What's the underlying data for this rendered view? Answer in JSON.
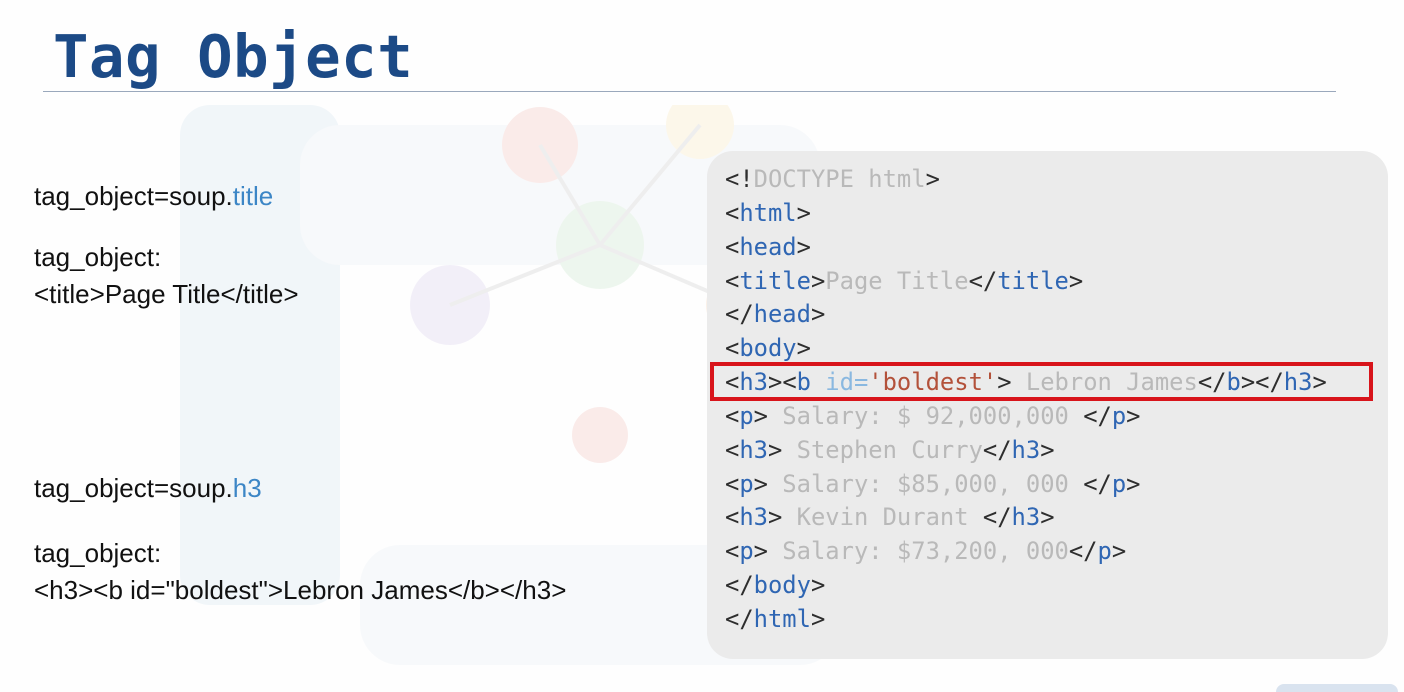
{
  "slide": {
    "title": "Tag Object"
  },
  "left": {
    "ex1_code_prefix": "tag_object=soup.",
    "ex1_code_attr": "title",
    "ex1_label": "tag_object:",
    "ex1_result": "<title>Page Title</title>",
    "ex2_code_prefix": "tag_object=soup.",
    "ex2_code_attr": "h3",
    "ex2_label": "tag_object:",
    "ex2_result": "<h3><b id=\"boldest\">Lebron James</b></h3>"
  },
  "code": {
    "l1_open": "<!",
    "l1_text": "DOCTYPE html",
    "l1_close": ">",
    "l2_open": "<",
    "l2_tag": "html",
    "l2_close": ">",
    "l3_open": "<",
    "l3_tag": "head",
    "l3_close": ">",
    "l4_open": "<",
    "l4_tag": "title",
    "l4_close": ">",
    "l4_text": "Page Title",
    "l4_open2": "</",
    "l4_tag2": "title",
    "l4_close2": ">",
    "l5_open": "</",
    "l5_tag": "head",
    "l5_close": ">",
    "l6_open": "<",
    "l6_tag": "body",
    "l6_close": ">",
    "l7_open": "<",
    "l7_tag": "h3",
    "l7_close": ">",
    "l7_open_b": "<",
    "l7_tag_b": "b ",
    "l7_attr": "id=",
    "l7_str": "'boldest'",
    "l7_close_b": ">",
    "l7_text": " Lebron James",
    "l7_end_b_open": "</",
    "l7_end_b_tag": "b",
    "l7_end_b_close": ">",
    "l7_end_h_open": "</",
    "l7_end_h_tag": "h3",
    "l7_end_h_close": ">",
    "l8_open": "<",
    "l8_tag": "p",
    "l8_close": ">",
    "l8_text": " Salary: $ 92,000,000 ",
    "l8_end_open": "</",
    "l8_end_tag": "p",
    "l8_end_close": ">",
    "l9_open": "<",
    "l9_tag": "h3",
    "l9_close": ">",
    "l9_text": " Stephen Curry",
    "l9_end_open": "</",
    "l9_end_tag": "h3",
    "l9_end_close": ">",
    "l10_open": "<",
    "l10_tag": "p",
    "l10_close": ">",
    "l10_text": " Salary: $85,000, 000 ",
    "l10_end_open": "</",
    "l10_end_tag": "p",
    "l10_end_close": ">",
    "l11_open": "<",
    "l11_tag": "h3",
    "l11_close": ">",
    "l11_text": " Kevin Durant ",
    "l11_end_open": "</",
    "l11_end_tag": "h3",
    "l11_end_close": ">",
    "l12_open": "<",
    "l12_tag": "p",
    "l12_close": ">",
    "l12_text": " Salary: $73,200, 000",
    "l12_end_open": "</",
    "l12_end_tag": "p",
    "l12_end_close": ">",
    "l13_open": "</",
    "l13_tag": "body",
    "l13_close": ">",
    "l14_open": "</",
    "l14_tag": "html",
    "l14_close": ">"
  },
  "colors": {
    "title": "#1c4a86",
    "accent": "#3c86c6",
    "tag": "#2f66b3",
    "faded_text": "#b9b9b9",
    "attribute": "#8ab8e0",
    "string": "#b3513a",
    "highlight_border": "#d8141b",
    "code_panel_bg": "#ebebeb"
  }
}
